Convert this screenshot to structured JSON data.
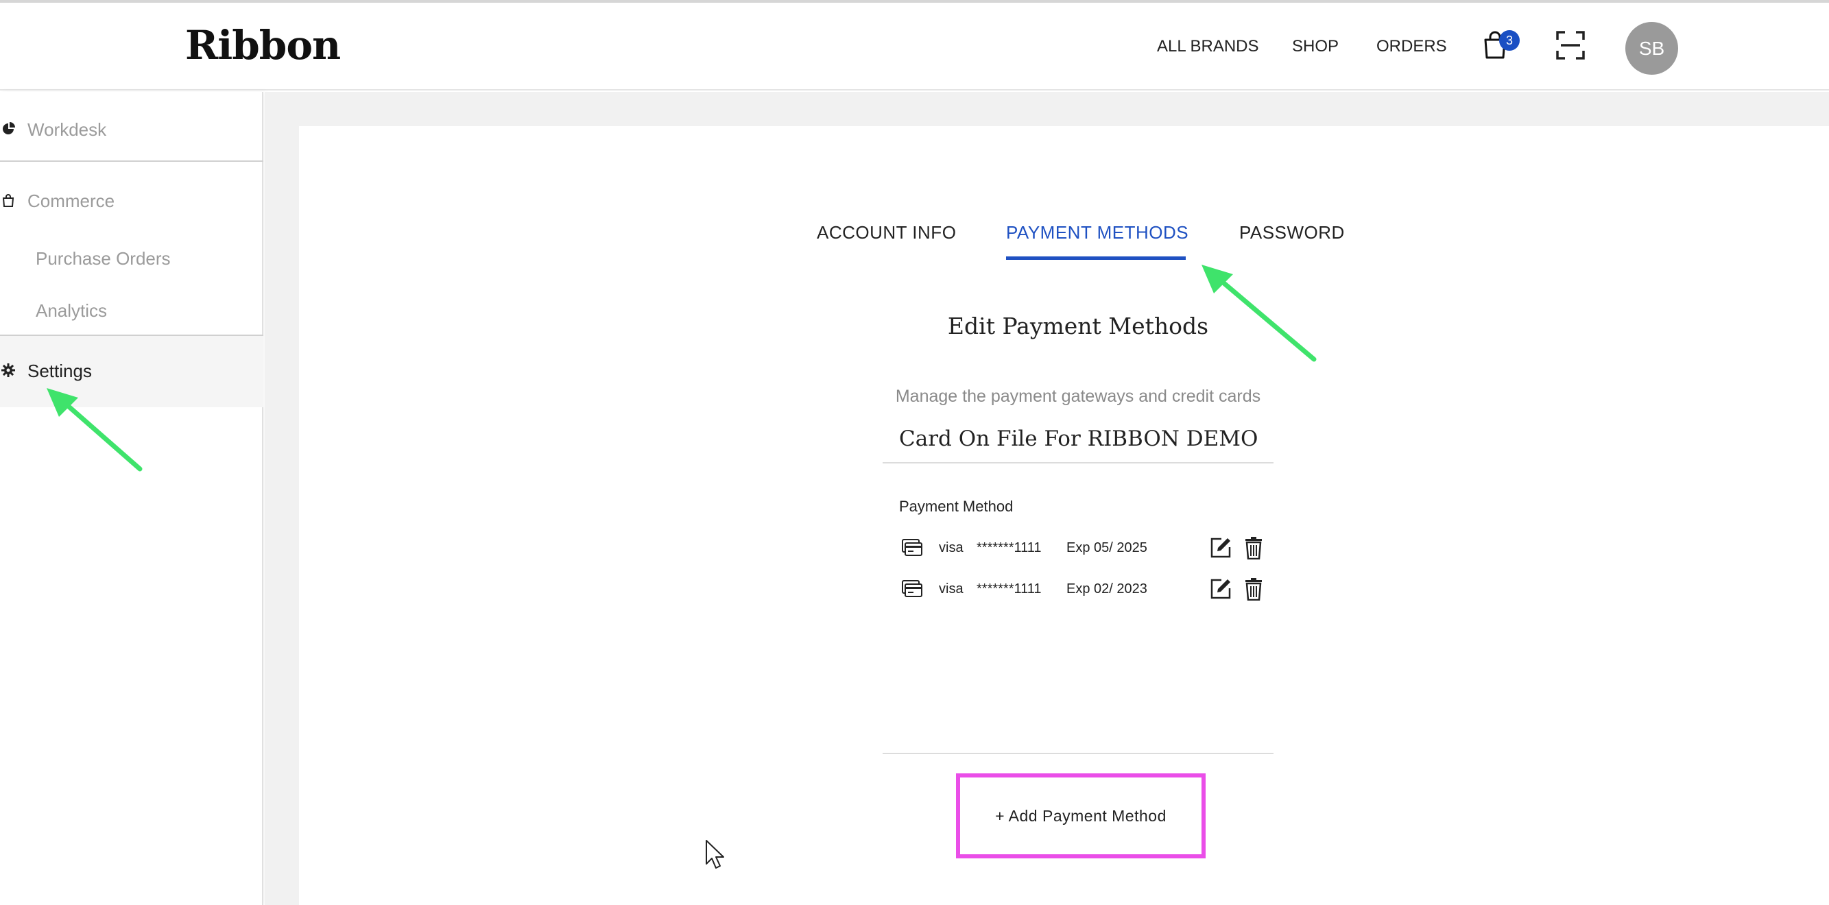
{
  "header": {
    "logo": "Ribbon",
    "nav": {
      "all_brands": "ALL BRANDS",
      "shop": "SHOP",
      "orders": "ORDERS"
    },
    "cart_count": "3",
    "avatar_initials": "SB"
  },
  "sidebar": {
    "workdesk": "Workdesk",
    "commerce": "Commerce",
    "purchase_orders": "Purchase Orders",
    "analytics": "Analytics",
    "settings": "Settings"
  },
  "tabs": {
    "account_info": "ACCOUNT INFO",
    "payment_methods": "PAYMENT METHODS",
    "password": "PASSWORD",
    "active": "payment_methods"
  },
  "content": {
    "title": "Edit Payment Methods",
    "subtitle": "Manage the payment gateways and credit cards",
    "card_on_file": "Card On File For RIBBON DEMO",
    "column_header": "Payment Method",
    "methods": [
      {
        "brand": "visa",
        "number": "*******1111",
        "expiry": "Exp 05/ 2025"
      },
      {
        "brand": "visa",
        "number": "*******1111",
        "expiry": "Exp 02/ 2023"
      }
    ],
    "add_button": "+ Add Payment Method"
  },
  "colors": {
    "accent_blue": "#1f51c2",
    "badge_blue": "#1a4fc3",
    "highlight_magenta": "#ea4ee8",
    "arrow_green": "#3fe36b"
  },
  "icons": {
    "cart": "shopping-bag-icon",
    "scan": "scan-frame-icon",
    "workdesk": "pie-chart-icon",
    "commerce": "bag-icon",
    "settings": "gear-icon",
    "card": "credit-card-icon",
    "edit": "edit-icon",
    "delete": "trash-icon"
  }
}
